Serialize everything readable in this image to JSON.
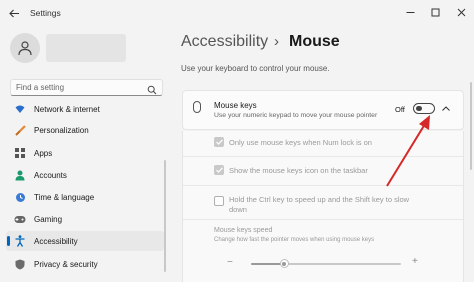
{
  "window": {
    "title": "Settings",
    "controls": [
      "minimize",
      "maximize",
      "close"
    ]
  },
  "sidebar": {
    "search_placeholder": "Find a setting",
    "items": [
      {
        "label": "Network & internet",
        "icon": "wifi-icon"
      },
      {
        "label": "Personalization",
        "icon": "brush-icon"
      },
      {
        "label": "Apps",
        "icon": "apps-icon"
      },
      {
        "label": "Accounts",
        "icon": "person-icon"
      },
      {
        "label": "Time & language",
        "icon": "globe-clock-icon"
      },
      {
        "label": "Gaming",
        "icon": "gamepad-icon"
      },
      {
        "label": "Accessibility",
        "icon": "accessibility-icon",
        "selected": true
      },
      {
        "label": "Privacy & security",
        "icon": "shield-icon"
      }
    ]
  },
  "main": {
    "breadcrumb_parent": "Accessibility",
    "breadcrumb_separator": "›",
    "breadcrumb_current": "Mouse",
    "description": "Use your keyboard to control your mouse.",
    "mouse_keys": {
      "title": "Mouse keys",
      "subtitle": "Use your numeric keypad to move your mouse pointer",
      "state_label": "Off",
      "enabled": false
    },
    "options": [
      {
        "label": "Only use mouse keys when Num lock is on",
        "checked": true
      },
      {
        "label": "Show the mouse keys icon on the taskbar",
        "checked": true
      },
      {
        "label": "Hold the Ctrl key to speed up and the Shift key to slow down",
        "line1": "Hold the Ctrl key to speed up and the Shift key to slow",
        "line2": "down",
        "checked": false
      }
    ],
    "speed": {
      "title": "Mouse keys speed",
      "subtitle": "Change how fast the pointer moves when using mouse keys",
      "minus": "−",
      "plus": "+",
      "value_fraction": 0.22
    }
  },
  "colors": {
    "accent": "#0067c0",
    "annotation_arrow": "#d62828"
  }
}
